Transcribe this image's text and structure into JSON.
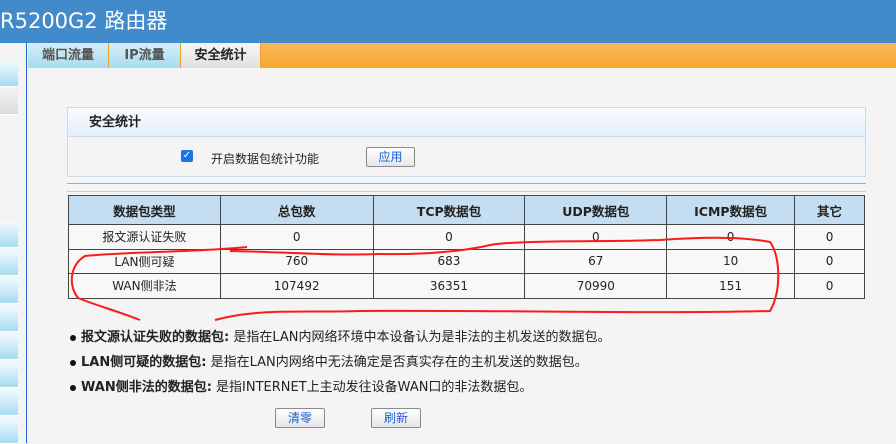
{
  "header": {
    "title": "R5200G2 路由器"
  },
  "tabs": [
    {
      "label": "端口流量",
      "active": false
    },
    {
      "label": "IP流量",
      "active": false
    },
    {
      "label": "安全统计",
      "active": true
    }
  ],
  "panel": {
    "title": "安全统计",
    "checkbox_label": "开启数据包统计功能",
    "checkbox_checked": true,
    "apply_label": "应用"
  },
  "table": {
    "headers": [
      "数据包类型",
      "总包数",
      "TCP数据包",
      "UDP数据包",
      "ICMP数据包",
      "其它"
    ],
    "rows": [
      [
        "报文源认证失败",
        "0",
        "0",
        "0",
        "0",
        "0"
      ],
      [
        "LAN侧可疑",
        "760",
        "683",
        "67",
        "10",
        "0"
      ],
      [
        "WAN侧非法",
        "107492",
        "36351",
        "70990",
        "151",
        "0"
      ]
    ]
  },
  "notes": [
    {
      "term": "报文源认证失败的数据包:",
      "desc": "是指在LAN内网络环境中本设备认为是非法的主机发送的数据包。"
    },
    {
      "term": "LAN侧可疑的数据包:",
      "desc": "是指在LAN内网络中无法确定是否真实存在的主机发送的数据包。"
    },
    {
      "term": "WAN侧非法的数据包:",
      "desc": "是指INTERNET上主动发往设备WAN口的非法数据包。"
    }
  ],
  "buttons": {
    "clear": "清零",
    "refresh": "刷新"
  },
  "colors": {
    "header": "#428bca",
    "tab_bar": "#f5a830",
    "annotation": "#ff0000"
  }
}
